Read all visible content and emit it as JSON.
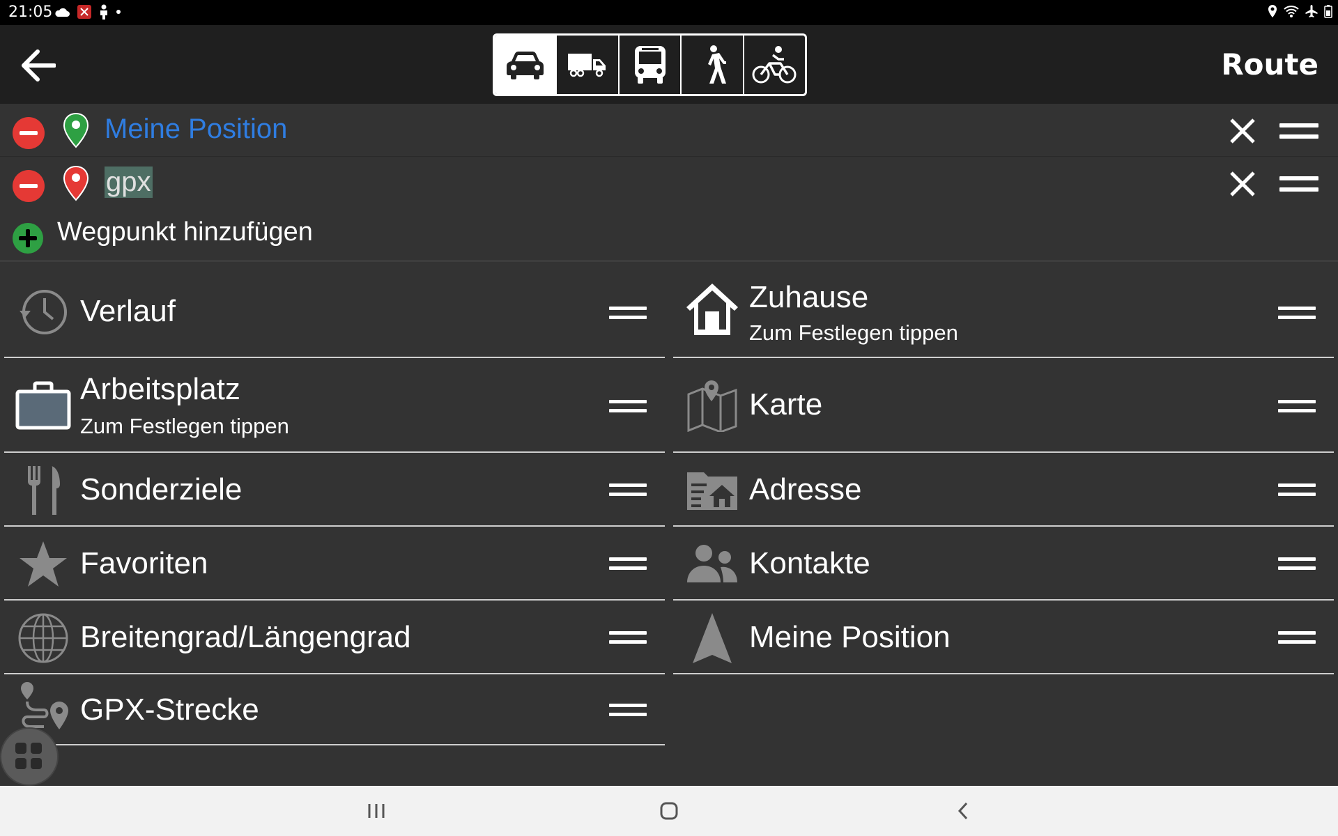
{
  "status_bar": {
    "time": "21:05"
  },
  "header": {
    "title": "Route",
    "modes": [
      {
        "name": "car",
        "selected": true
      },
      {
        "name": "truck",
        "selected": false
      },
      {
        "name": "bus",
        "selected": false
      },
      {
        "name": "pedestrian",
        "selected": false
      },
      {
        "name": "bicycle",
        "selected": false
      }
    ]
  },
  "waypoints": [
    {
      "label": "Meine Position",
      "pin_color": "#2ea043",
      "text_color": "#2f7de1"
    },
    {
      "label": "gpx",
      "pin_color": "#e53935",
      "selected_text": true
    }
  ],
  "add_waypoint_label": "Wegpunkt hinzufügen",
  "items_left": [
    {
      "title": "Verlauf",
      "icon": "history-icon"
    },
    {
      "title": "Arbeitsplatz",
      "subtitle": "Zum Festlegen tippen",
      "icon": "briefcase-icon"
    },
    {
      "title": "Sonderziele",
      "icon": "restaurant-icon"
    },
    {
      "title": "Favoriten",
      "icon": "star-icon"
    },
    {
      "title": "Breitengrad/Längengrad",
      "icon": "globe-icon"
    },
    {
      "title": "GPX-Strecke",
      "icon": "gpx-track-icon"
    }
  ],
  "items_right": [
    {
      "title": "Zuhause",
      "subtitle": "Zum Festlegen tippen",
      "icon": "home-icon"
    },
    {
      "title": "Karte",
      "icon": "map-icon"
    },
    {
      "title": "Adresse",
      "icon": "address-icon"
    },
    {
      "title": "Kontakte",
      "icon": "contacts-icon"
    },
    {
      "title": "Meine Position",
      "icon": "location-arrow-icon"
    }
  ],
  "colors": {
    "background": "#333333",
    "appbar": "#1f1f1f",
    "accent_blue": "#2f7de1",
    "remove_red": "#e53935",
    "add_green": "#2ea043",
    "icon_gray": "#8a8a8a"
  }
}
